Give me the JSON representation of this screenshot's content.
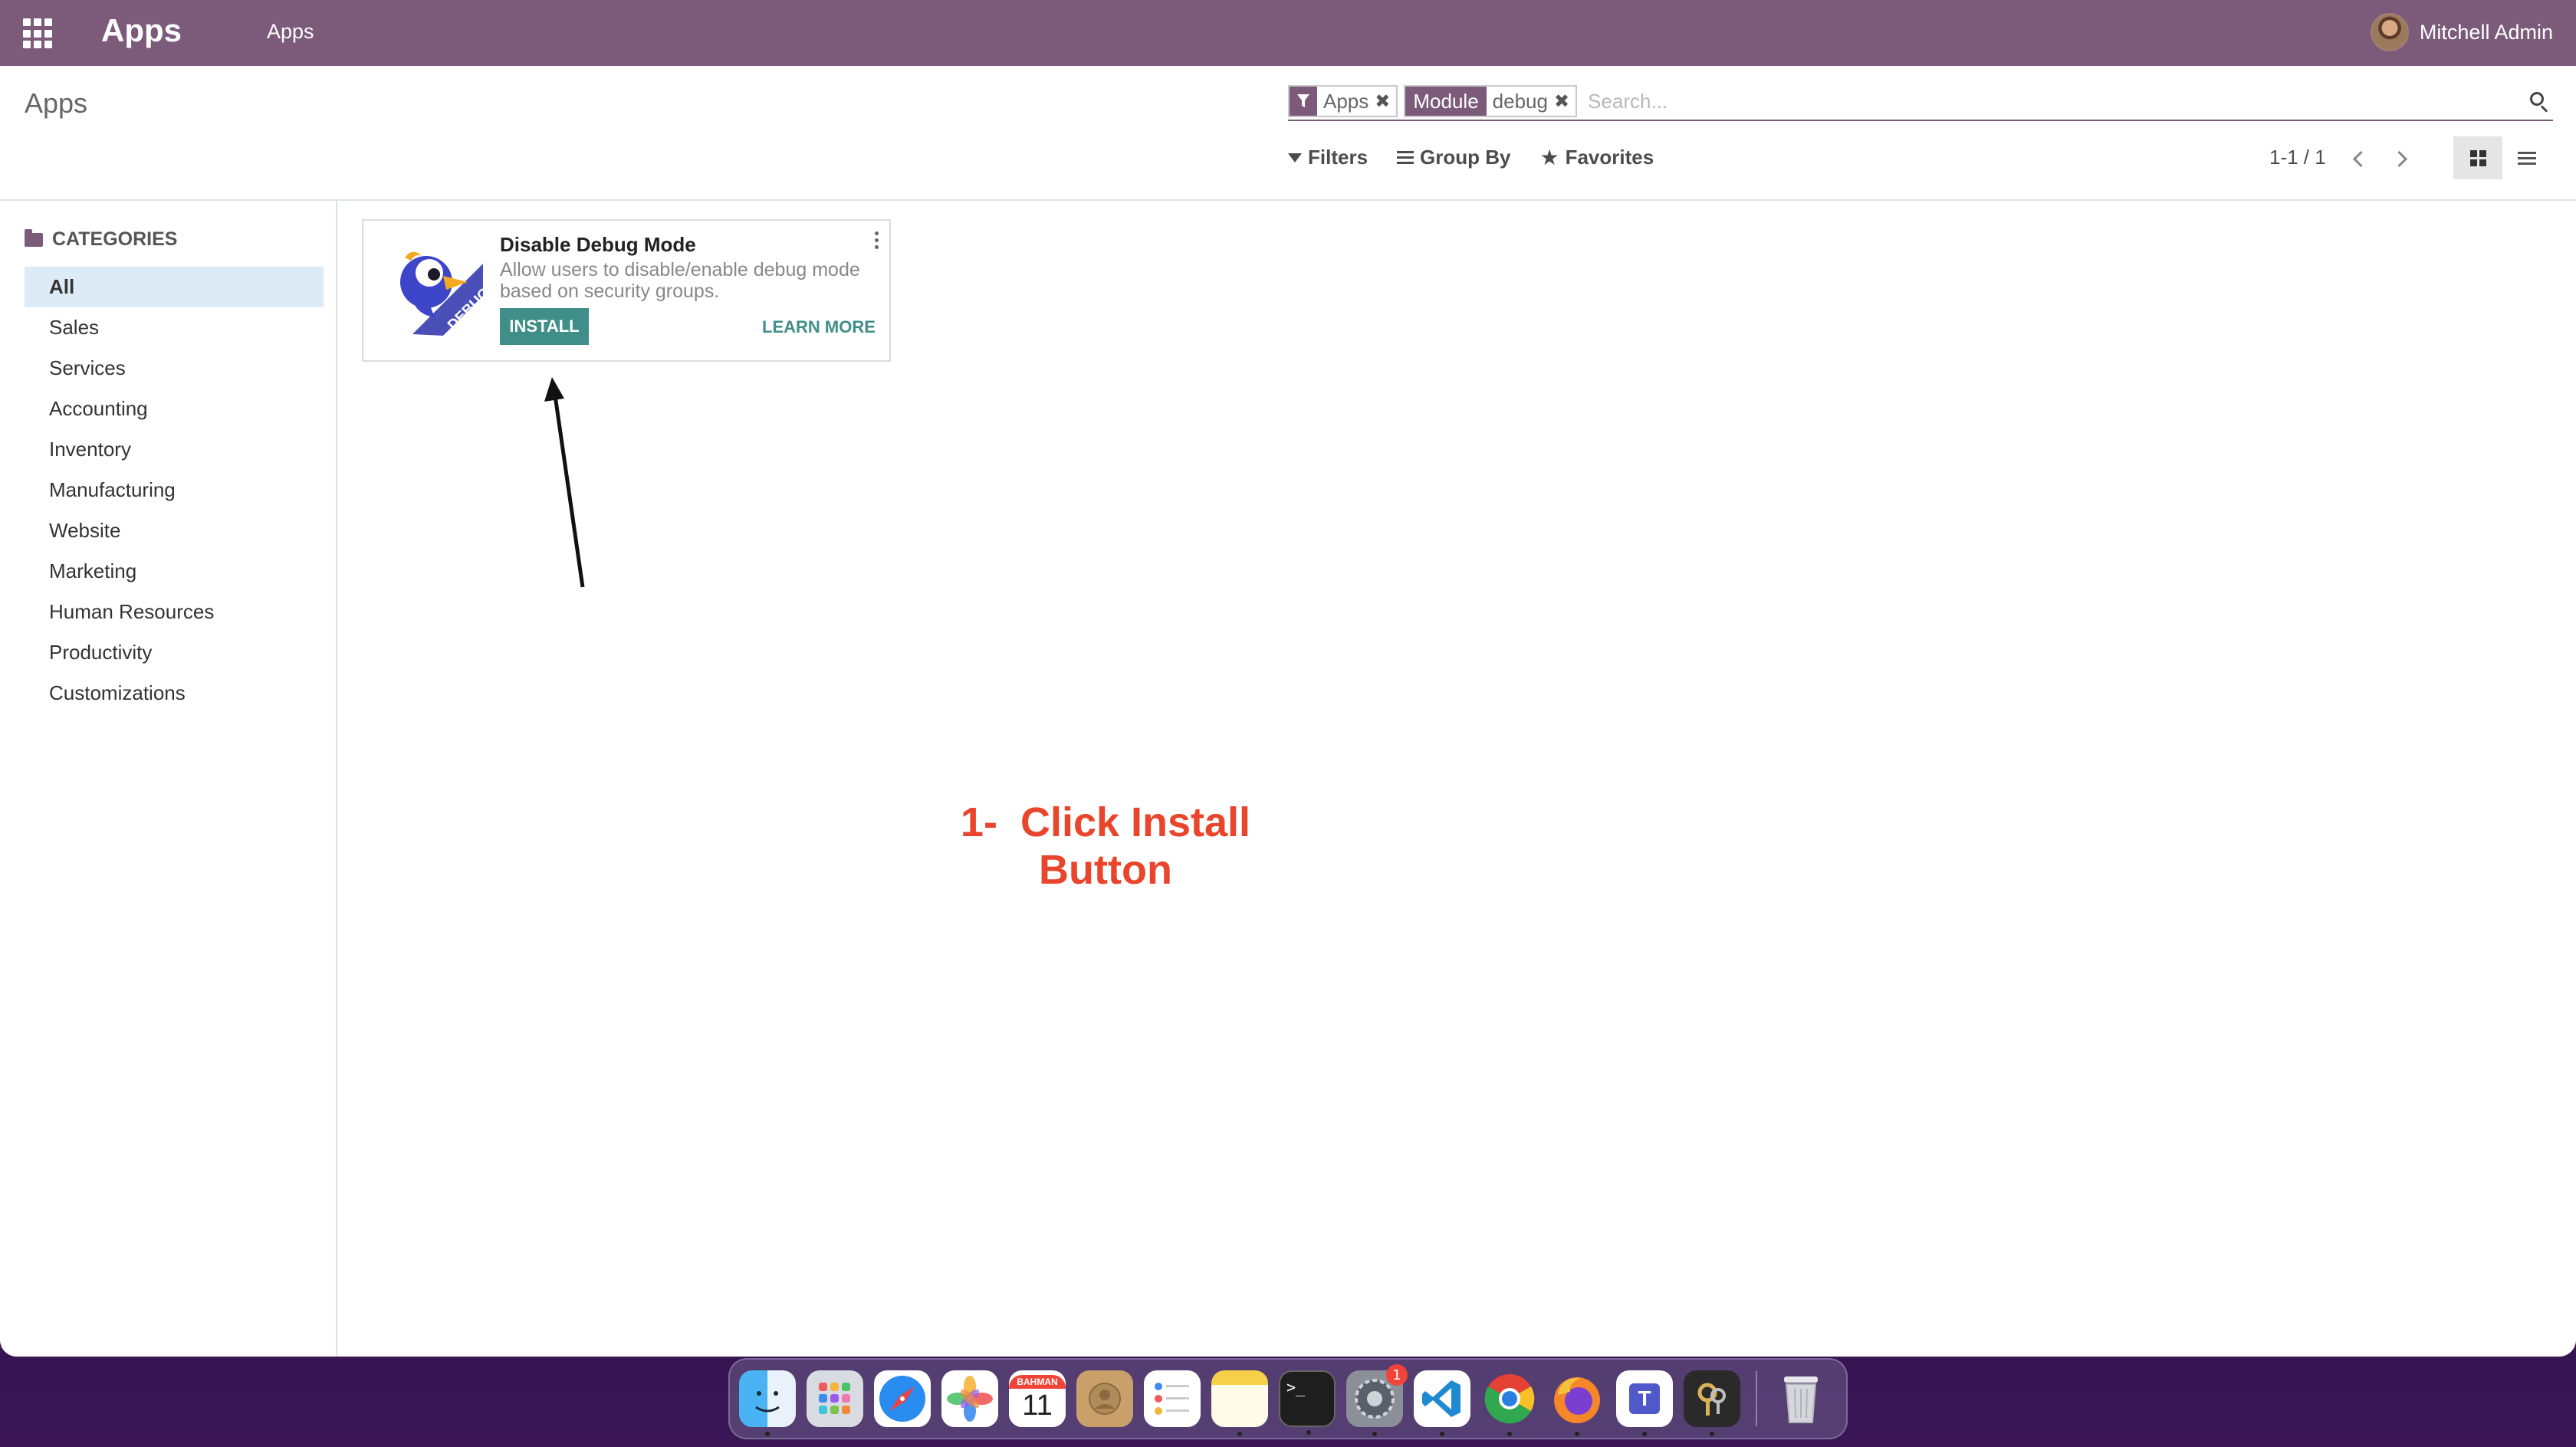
{
  "navbar": {
    "brand": "Apps",
    "menu_item": "Apps",
    "user_name": "Mitchell Admin"
  },
  "control_panel": {
    "title": "Apps",
    "facets": [
      {
        "icon": "filter-icon",
        "label": "",
        "value": "Apps"
      },
      {
        "icon": "",
        "label": "Module",
        "value": "debug"
      }
    ],
    "search_placeholder": "Search...",
    "filters_label": "Filters",
    "groupby_label": "Group By",
    "favorites_label": "Favorites",
    "pager_value": "1-1 / 1"
  },
  "sidebar": {
    "header": "CATEGORIES",
    "items": [
      {
        "label": "All",
        "active": true
      },
      {
        "label": "Sales"
      },
      {
        "label": "Services"
      },
      {
        "label": "Accounting"
      },
      {
        "label": "Inventory"
      },
      {
        "label": "Manufacturing"
      },
      {
        "label": "Website"
      },
      {
        "label": "Marketing"
      },
      {
        "label": "Human Resources"
      },
      {
        "label": "Productivity"
      },
      {
        "label": "Customizations"
      }
    ]
  },
  "card": {
    "title": "Disable Debug Mode",
    "description": "Allow users to disable/enable debug mode based on security groups.",
    "install_label": "INSTALL",
    "learn_more_label": "LEARN MORE",
    "logo_text": "DEBUG"
  },
  "annotation": {
    "text": "1-  Click Install\nButton",
    "color": "#e8452c"
  },
  "dock": {
    "apps": [
      {
        "name": "finder",
        "icon": "finder-icon"
      },
      {
        "name": "launchpad",
        "icon": "launchpad-icon"
      },
      {
        "name": "safari",
        "icon": "safari-icon"
      },
      {
        "name": "photos",
        "icon": "photos-icon"
      },
      {
        "name": "calendar",
        "icon": "calendar-icon",
        "month": "BAHMAN",
        "day": "11"
      },
      {
        "name": "contacts",
        "icon": "contacts-icon"
      },
      {
        "name": "reminders",
        "icon": "reminders-icon"
      },
      {
        "name": "notes",
        "icon": "notes-icon"
      },
      {
        "name": "terminal",
        "icon": "terminal-icon",
        "glyph": ">_"
      },
      {
        "name": "system-settings",
        "icon": "settings-icon",
        "badge": "1"
      },
      {
        "name": "vscode",
        "icon": "vscode-icon"
      },
      {
        "name": "chrome",
        "icon": "chrome-icon"
      },
      {
        "name": "firefox",
        "icon": "firefox-icon"
      },
      {
        "name": "teams",
        "icon": "teams-icon",
        "glyph": "T"
      },
      {
        "name": "keychain",
        "icon": "keychain-icon"
      },
      {
        "name": "trash",
        "icon": "trash-icon"
      }
    ]
  },
  "colors": {
    "brand": "#7c5b7a",
    "install": "#3f8e87",
    "active_category": "#dcebf5"
  }
}
